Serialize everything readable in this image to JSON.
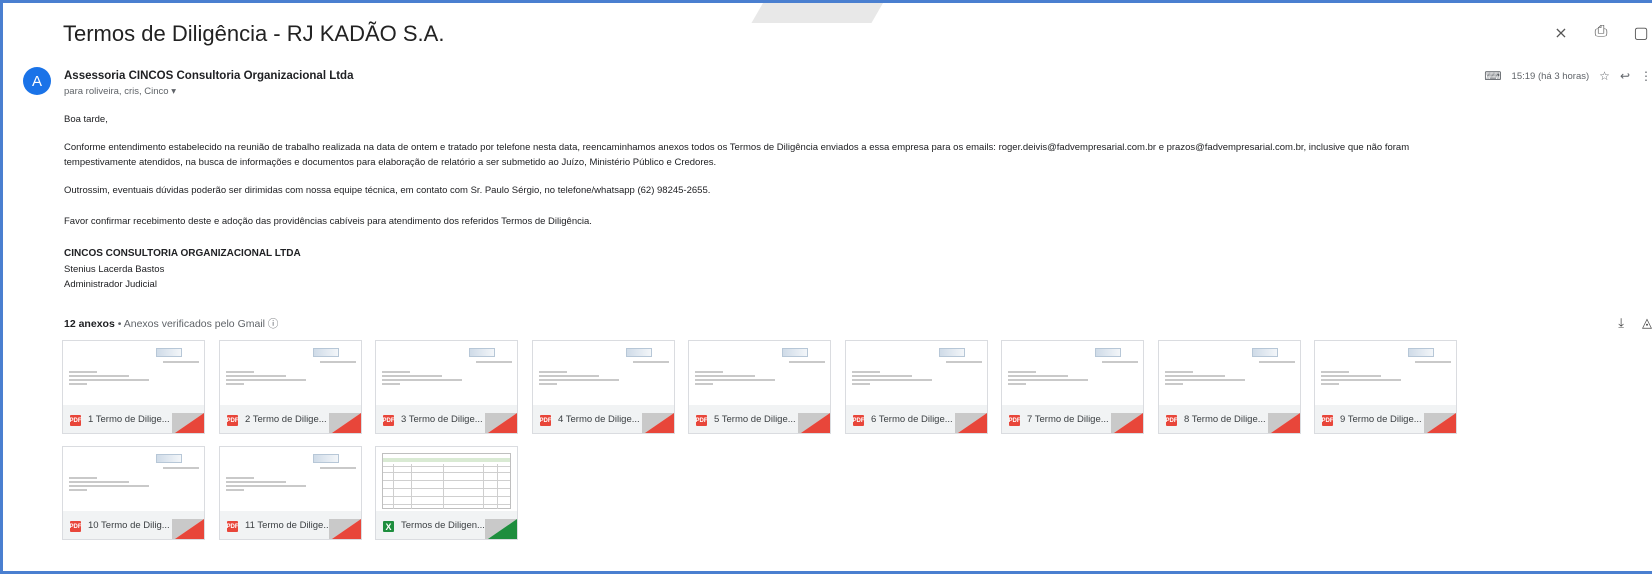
{
  "email": {
    "subject": "Termos de Diligência - RJ KADÃO S.A.",
    "header_icons": [
      "collapse-icon",
      "print-icon",
      "open-new-window-icon"
    ],
    "avatar_letter": "A",
    "sender": "Assessoria CINCOS Consultoria Organizacional Ltda",
    "recipients": "para roliveira, cris, Cinco",
    "time": "15:19 (há 3 horas)",
    "greeting": "Boa tarde,",
    "paragraph1_line1": "Conforme entendimento estabelecido na reunião de trabalho realizada na data de ontem e tratado por telefone nesta data, reencaminhamos anexos todos os Termos de Diligência enviados a essa empresa para os emails: roger.deivis@fadvempresarial.com.br e prazos@fadvempresarial.com.br, inclusive que não foram",
    "paragraph1_line2": "tempestivamente atendidos, na busca de informações e documentos para elaboração de relatório a ser submetido ao Juízo, Ministério Público e Credores.",
    "paragraph2": "Outrossim, eventuais dúvidas poderão ser dirimidas com nossa equipe técnica, em contato com Sr. Paulo Sérgio, no telefone/whatsapp (62) 98245-2655.",
    "paragraph3": "Favor confirmar recebimento deste e adoção das providências cabíveis para atendimento dos referidos Termos de Diligência.",
    "signature_company": "CINCOS CONSULTORIA ORGANIZACIONAL LTDA",
    "signature_name": "Stenius Lacerda Bastos",
    "signature_role": "Administrador Judicial"
  },
  "attachments_section": {
    "count_label": "12 anexos",
    "separator": "•",
    "verified_label": "Anexos verificados pelo Gmail",
    "info_icon": "ⓘ"
  },
  "attachments": [
    {
      "name": "1 Termo de Dilige...",
      "type": "pdf"
    },
    {
      "name": "2 Termo de Dilige...",
      "type": "pdf"
    },
    {
      "name": "3 Termo de Dilige...",
      "type": "pdf"
    },
    {
      "name": "4 Termo de Dilige...",
      "type": "pdf"
    },
    {
      "name": "5 Termo de Dilige...",
      "type": "pdf"
    },
    {
      "name": "6 Termo de Dilige...",
      "type": "pdf"
    },
    {
      "name": "7 Termo de Dilige...",
      "type": "pdf"
    },
    {
      "name": "8 Termo de Dilige...",
      "type": "pdf"
    },
    {
      "name": "9 Termo de Dilige...",
      "type": "pdf"
    },
    {
      "name": "10 Termo de Dilig...",
      "type": "pdf"
    },
    {
      "name": "11 Termo de Dilige...",
      "type": "pdf"
    },
    {
      "name": "Termos de Diligen...",
      "type": "xls"
    }
  ],
  "colors": {
    "accent": "#1a73e8",
    "pdf": "#e8463a",
    "xls": "#1e8e3e",
    "frame": "#4a7fd0"
  }
}
